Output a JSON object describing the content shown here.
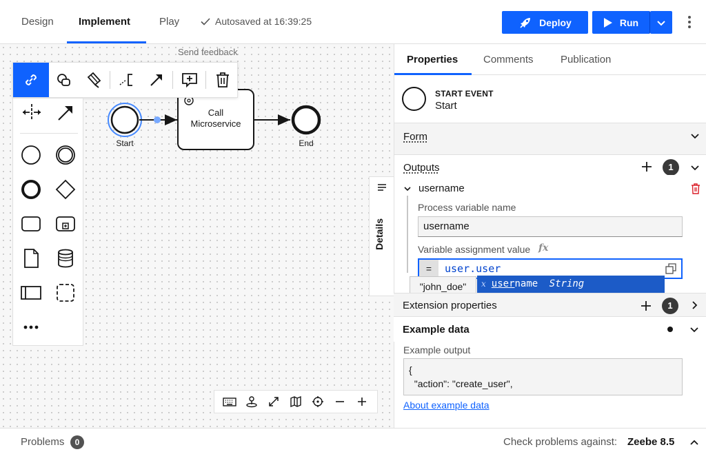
{
  "top_tabs": [
    {
      "label": "Design"
    },
    {
      "label": "Implement"
    },
    {
      "label": "Play"
    }
  ],
  "autosave": "Autosaved at 16:39:25",
  "deploy_label": "Deploy",
  "run_label": "Run",
  "canvas": {
    "feedback": "Send feedback",
    "start_label": "Start",
    "task_label": "Call Microservice",
    "end_label": "End",
    "details_label": "Details"
  },
  "panel": {
    "tabs": [
      {
        "label": "Properties"
      },
      {
        "label": "Comments"
      },
      {
        "label": "Publication"
      }
    ],
    "element_type": "START EVENT",
    "element_name": "Start",
    "form_label": "Form",
    "outputs_label": "Outputs",
    "outputs_count": "1",
    "output_name": "username",
    "process_var_label": "Process variable name",
    "process_var_value": "username",
    "assignment_label": "Variable assignment value",
    "fx_label": "fx",
    "feel_eq": "=",
    "feel_value": "user.user",
    "autocomplete_kind": "x",
    "autocomplete_match": "user",
    "autocomplete_rest": "name",
    "autocomplete_type": "String",
    "tooltip_value": "\"john_doe\"",
    "extension_label": "Extension properties",
    "extension_count": "1",
    "example_label": "Example data",
    "example_output_label": "Example output",
    "example_output_value": "{\n  \"action\": \"create_user\",",
    "example_link": "About example data"
  },
  "status": {
    "problems_label": "Problems",
    "problems_count": "0",
    "check_label": "Check problems against:",
    "engine": "Zeebe 8.5"
  },
  "colors": {
    "accent": "#0f62fe",
    "delete_icon": "#da1e28",
    "start_selection": "#4589ff"
  }
}
